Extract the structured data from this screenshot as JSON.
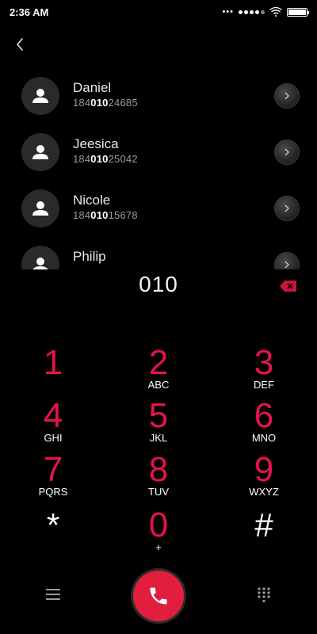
{
  "status_bar": {
    "time": "2:36 AM",
    "battery_level": 1.0
  },
  "contacts": [
    {
      "name": "Daniel",
      "number_prefix": "184",
      "number_match": "010",
      "number_suffix": "24685"
    },
    {
      "name": "Jeesica",
      "number_prefix": "184",
      "number_match": "010",
      "number_suffix": "25042"
    },
    {
      "name": "Nicole",
      "number_prefix": "184",
      "number_match": "010",
      "number_suffix": "15678"
    },
    {
      "name": "Philip",
      "number_prefix": "",
      "number_match": "",
      "number_suffix": ""
    }
  ],
  "dialer": {
    "entered_number": "010"
  },
  "keypad": {
    "keys": [
      {
        "digit": "1",
        "letters": ""
      },
      {
        "digit": "2",
        "letters": "ABC"
      },
      {
        "digit": "3",
        "letters": "DEF"
      },
      {
        "digit": "4",
        "letters": "GHI"
      },
      {
        "digit": "5",
        "letters": "JKL"
      },
      {
        "digit": "6",
        "letters": "MNO"
      },
      {
        "digit": "7",
        "letters": "PQRS"
      },
      {
        "digit": "8",
        "letters": "TUV"
      },
      {
        "digit": "9",
        "letters": "WXYZ"
      },
      {
        "digit": "*",
        "letters": ""
      },
      {
        "digit": "0",
        "letters": "+"
      },
      {
        "digit": "#",
        "letters": ""
      }
    ]
  },
  "colors": {
    "accent": "#e4134a",
    "call_button": "#e21e3f",
    "background": "#000000"
  },
  "icons": {
    "back": "chevron-left-icon",
    "avatar": "person-icon",
    "detail": "arrow-right-icon",
    "delete": "backspace-icon",
    "menu": "menu-icon",
    "call": "phone-icon",
    "dialpad": "dialpad-icon"
  }
}
